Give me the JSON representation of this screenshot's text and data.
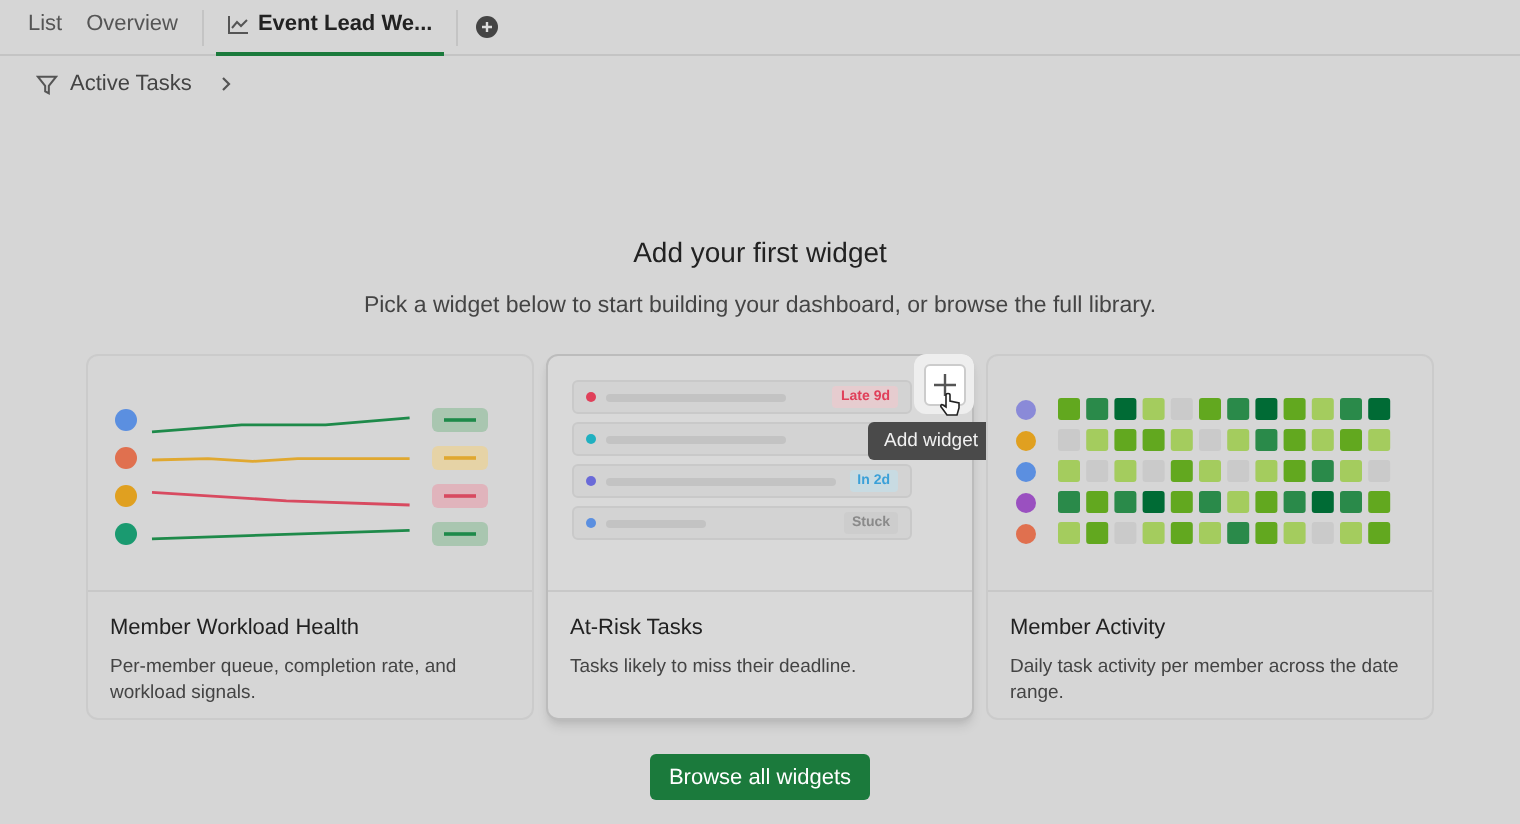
{
  "tabs": [
    {
      "label": "List",
      "selected": false,
      "kind": "text"
    },
    {
      "label": "Overview",
      "selected": false,
      "kind": "text"
    },
    {
      "label": "Event Lead We...",
      "selected": true,
      "kind": "chart"
    }
  ],
  "filter": {
    "label": "Active Tasks"
  },
  "heading": "Add your first widget",
  "subheading": "Pick a widget below to start building your dashboard, or browse the full library.",
  "widgets": [
    {
      "kind": "lines",
      "title": "Member Workload Health",
      "description": "Per-member queue, completion rate, and workload signals.",
      "highlighted": false
    },
    {
      "kind": "tasks",
      "title": "At-Risk Tasks",
      "description": "Tasks likely to miss their deadline.",
      "highlighted": true,
      "rows": [
        {
          "color": "#e0405a",
          "badge": {
            "text": "Late 9d",
            "color": "#e0405a"
          }
        },
        {
          "color": "#20b0c0"
        },
        {
          "color": "#6a6ad8",
          "badge": {
            "text": "In 2d",
            "color": "#3aa0d8"
          }
        },
        {
          "color": "#5b8fe0",
          "badge": {
            "text": "Stuck",
            "color": "#8a8a8a"
          }
        }
      ],
      "tooltip": "Add widget"
    },
    {
      "kind": "heatmap",
      "title": "Member Activity",
      "description": "Daily task activity per member across the date range.",
      "highlighted": false
    }
  ],
  "browse_button": "Browse all widgets"
}
